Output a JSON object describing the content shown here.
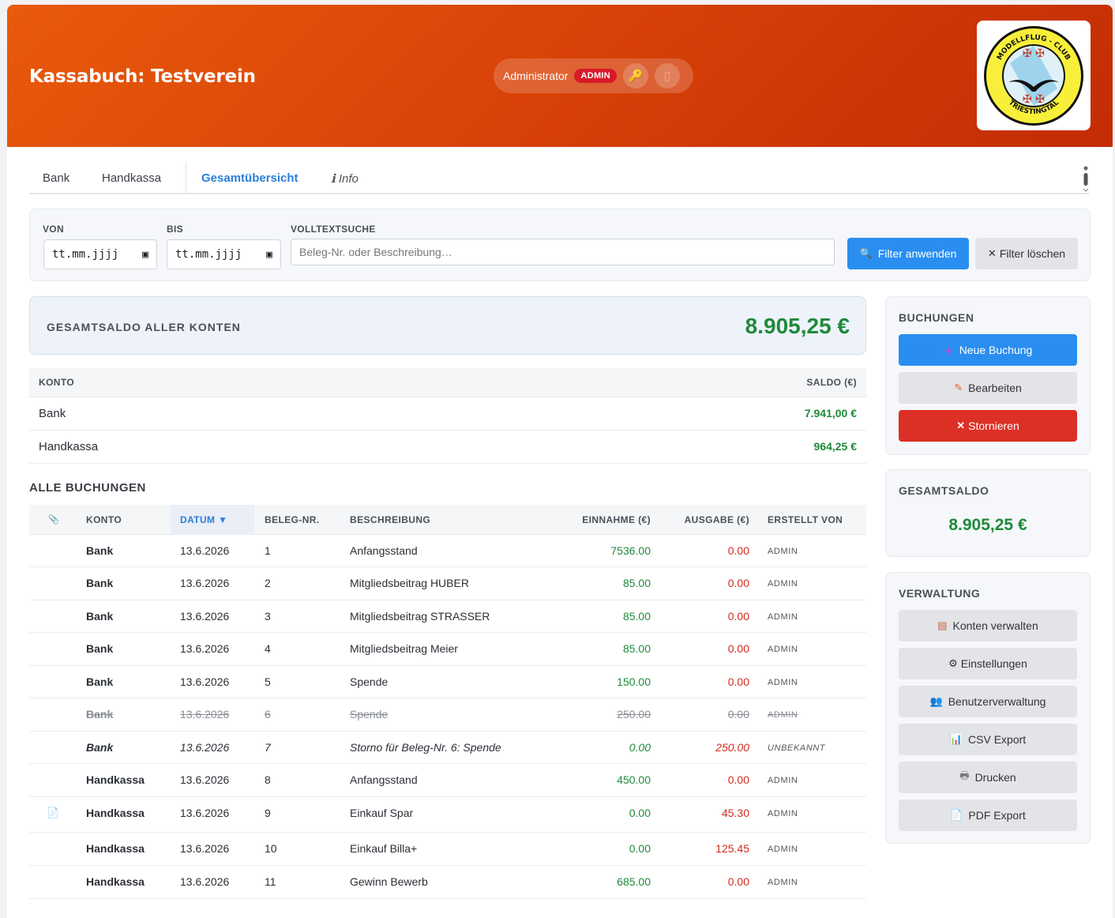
{
  "header": {
    "title": "Kassabuch: Testverein",
    "user_name": "Administrator",
    "user_role": "ADMIN",
    "logo_text_top": "MODELLFLUG - CLUB",
    "logo_text_bottom": "TRIESTINGTAL"
  },
  "tabs": [
    {
      "label": "Bank",
      "active": false
    },
    {
      "label": "Handkassa",
      "active": false
    },
    {
      "label": "Gesamtübersicht",
      "active": true
    },
    {
      "label": "ℹ Info",
      "active": false
    }
  ],
  "filter": {
    "von_label": "VON",
    "von_value": "tt.mm.jjjj",
    "bis_label": "BIS",
    "bis_value": "tt.mm.jjjj",
    "search_label": "VOLLTEXTSUCHE",
    "search_placeholder": "Beleg-Nr. oder Beschreibung…",
    "apply_label": "Filter anwenden",
    "clear_label": "Filter löschen"
  },
  "overview": {
    "label": "GESAMTSALDO ALLER KONTEN",
    "value": "8.905,25 €",
    "col_konto": "KONTO",
    "col_saldo": "SALDO (€)",
    "accounts": [
      {
        "name": "Bank",
        "saldo": "7.941,00 €"
      },
      {
        "name": "Handkassa",
        "saldo": "964,25 €"
      }
    ]
  },
  "bookings": {
    "title": "ALLE BUCHUNGEN",
    "headers": {
      "attachment": "📎",
      "konto": "KONTO",
      "datum": "DATUM ▼",
      "beleg": "BELEG-NR.",
      "desc": "BESCHREIBUNG",
      "ein": "EINNAHME (€)",
      "aus": "AUSGABE (€)",
      "by": "ERSTELLT VON"
    },
    "rows": [
      {
        "konto": "Bank",
        "datum": "13.6.2026",
        "beleg": "1",
        "desc": "Anfangsstand",
        "ein": "7536.00",
        "aus": "0.00",
        "by": "ADMIN",
        "state": "",
        "att": ""
      },
      {
        "konto": "Bank",
        "datum": "13.6.2026",
        "beleg": "2",
        "desc": "Mitgliedsbeitrag HUBER",
        "ein": "85.00",
        "aus": "0.00",
        "by": "ADMIN",
        "state": "",
        "att": ""
      },
      {
        "konto": "Bank",
        "datum": "13.6.2026",
        "beleg": "3",
        "desc": "Mitgliedsbeitrag STRASSER",
        "ein": "85.00",
        "aus": "0.00",
        "by": "ADMIN",
        "state": "",
        "att": ""
      },
      {
        "konto": "Bank",
        "datum": "13.6.2026",
        "beleg": "4",
        "desc": "Mitgliedsbeitrag Meier",
        "ein": "85.00",
        "aus": "0.00",
        "by": "ADMIN",
        "state": "",
        "att": ""
      },
      {
        "konto": "Bank",
        "datum": "13.6.2026",
        "beleg": "5",
        "desc": "Spende",
        "ein": "150.00",
        "aus": "0.00",
        "by": "ADMIN",
        "state": "",
        "att": ""
      },
      {
        "konto": "Bank",
        "datum": "13.6.2026",
        "beleg": "6",
        "desc": "Spende",
        "ein": "250.00",
        "aus": "0.00",
        "by": "ADMIN",
        "state": "storniert",
        "att": ""
      },
      {
        "konto": "Bank",
        "datum": "13.6.2026",
        "beleg": "7",
        "desc": "Storno für Beleg-Nr. 6: Spende",
        "ein": "0.00",
        "aus": "250.00",
        "by": "UNBEKANNT",
        "state": "storno",
        "att": ""
      },
      {
        "konto": "Handkassa",
        "datum": "13.6.2026",
        "beleg": "8",
        "desc": "Anfangsstand",
        "ein": "450.00",
        "aus": "0.00",
        "by": "ADMIN",
        "state": "",
        "att": ""
      },
      {
        "konto": "Handkassa",
        "datum": "13.6.2026",
        "beleg": "9",
        "desc": "Einkauf Spar",
        "ein": "0.00",
        "aus": "45.30",
        "by": "ADMIN",
        "state": "",
        "att": "📄"
      },
      {
        "konto": "Handkassa",
        "datum": "13.6.2026",
        "beleg": "10",
        "desc": "Einkauf Billa+",
        "ein": "0.00",
        "aus": "125.45",
        "by": "ADMIN",
        "state": "",
        "att": ""
      },
      {
        "konto": "Handkassa",
        "datum": "13.6.2026",
        "beleg": "11",
        "desc": "Gewinn Bewerb",
        "ein": "685.00",
        "aus": "0.00",
        "by": "ADMIN",
        "state": "",
        "att": ""
      }
    ]
  },
  "sidebar": {
    "buchungen_title": "BUCHUNGEN",
    "neue": "Neue Buchung",
    "bearbeiten": "Bearbeiten",
    "stornieren": "Stornieren",
    "saldo_title": "GESAMTSALDO",
    "saldo_value": "8.905,25 €",
    "verwaltung_title": "VERWALTUNG",
    "konten": "Konten verwalten",
    "einstellungen": "Einstellungen",
    "benutzer": "Benutzerverwaltung",
    "csv": "CSV Export",
    "drucken": "Drucken",
    "pdf": "PDF Export"
  },
  "colors": {
    "header_start": "#e85a0c",
    "header_end": "#c32c06",
    "accent_blue": "#2a8ef0",
    "positive": "#1f8a3b",
    "negative": "#d42a22",
    "danger": "#dc2f26"
  }
}
